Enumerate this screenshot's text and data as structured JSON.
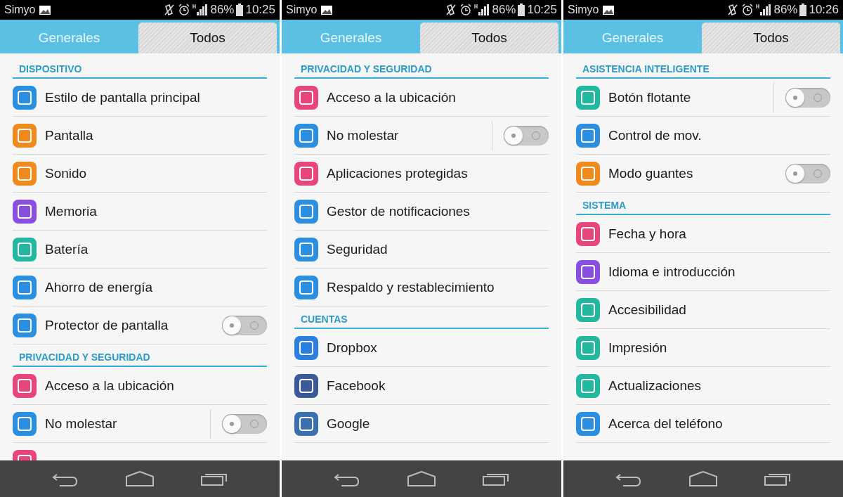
{
  "panels": [
    {
      "status_bar": {
        "carrier": "Simyo",
        "battery": "86%",
        "time": "10:25"
      },
      "tabs": [
        {
          "label": "Generales",
          "selected": false
        },
        {
          "label": "Todos",
          "selected": true
        }
      ],
      "sections": [
        {
          "title": "DISPOSITIVO",
          "items": [
            {
              "label": "Estilo de pantalla principal",
              "color": "#2a8fe0",
              "kind": "plain"
            },
            {
              "label": "Pantalla",
              "color": "#f08a1c",
              "kind": "plain"
            },
            {
              "label": "Sonido",
              "color": "#f08a1c",
              "kind": "plain"
            },
            {
              "label": "Memoria",
              "color": "#8a4fe0",
              "kind": "plain"
            },
            {
              "label": "Batería",
              "color": "#22b8a0",
              "kind": "plain"
            },
            {
              "label": "Ahorro de energía",
              "color": "#2a8fe0",
              "kind": "plain"
            },
            {
              "label": "Protector de pantalla",
              "color": "#2a8fe0",
              "kind": "toggle",
              "on": false
            }
          ]
        },
        {
          "title": "PRIVACIDAD Y SEGURIDAD",
          "items": [
            {
              "label": "Acceso a la ubicación",
              "color": "#e8457a",
              "kind": "plain"
            },
            {
              "label": "No molestar",
              "color": "#2a8fe0",
              "kind": "split-toggle",
              "on": false
            },
            {
              "color": "#e8457a",
              "kind": "partial"
            }
          ]
        }
      ]
    },
    {
      "status_bar": {
        "carrier": "Simyo",
        "battery": "86%",
        "time": "10:25"
      },
      "tabs": [
        {
          "label": "Generales",
          "selected": false
        },
        {
          "label": "Todos",
          "selected": true
        }
      ],
      "sections": [
        {
          "title": "PRIVACIDAD Y SEGURIDAD",
          "items": [
            {
              "label": "Acceso a la ubicación",
              "color": "#e8457a",
              "kind": "plain"
            },
            {
              "label": "No molestar",
              "color": "#2a8fe0",
              "kind": "split-toggle",
              "on": false
            },
            {
              "label": "Aplicaciones protegidas",
              "color": "#e8457a",
              "kind": "plain"
            },
            {
              "label": "Gestor de notificaciones",
              "color": "#2a8fe0",
              "kind": "plain"
            },
            {
              "label": "Seguridad",
              "color": "#2a8fe0",
              "kind": "plain"
            },
            {
              "label": "Respaldo y restablecimiento",
              "color": "#2a8fe0",
              "kind": "plain"
            }
          ]
        },
        {
          "title": "CUENTAS",
          "items": [
            {
              "label": "Dropbox",
              "color": "#2a7fe0",
              "kind": "plain"
            },
            {
              "label": "Facebook",
              "color": "#3b5998",
              "kind": "plain"
            },
            {
              "label": "Google",
              "color": "#3a6fb0",
              "kind": "plain"
            }
          ]
        }
      ]
    },
    {
      "status_bar": {
        "carrier": "Simyo",
        "battery": "86%",
        "time": "10:26"
      },
      "tabs": [
        {
          "label": "Generales",
          "selected": false
        },
        {
          "label": "Todos",
          "selected": true
        }
      ],
      "sections": [
        {
          "title": "ASISTENCIA INTELIGENTE",
          "items": [
            {
              "label": "Botón flotante",
              "color": "#22b8a0",
              "kind": "split-toggle",
              "on": false
            },
            {
              "label": "Control de mov.",
              "color": "#2a8fe0",
              "kind": "plain"
            },
            {
              "label": "Modo guantes",
              "color": "#f08a1c",
              "kind": "toggle",
              "on": false
            }
          ]
        },
        {
          "title": "SISTEMA",
          "items": [
            {
              "label": "Fecha y hora",
              "color": "#e8457a",
              "kind": "plain"
            },
            {
              "label": "Idioma e introducción",
              "color": "#8a4fe0",
              "kind": "plain"
            },
            {
              "label": "Accesibilidad",
              "color": "#22b8a0",
              "kind": "plain"
            },
            {
              "label": "Impresión",
              "color": "#22b8a0",
              "kind": "plain"
            },
            {
              "label": "Actualizaciones",
              "color": "#22b8a0",
              "kind": "plain"
            },
            {
              "label": "Acerca del teléfono",
              "color": "#2a8fe0",
              "kind": "plain"
            }
          ]
        }
      ]
    }
  ]
}
